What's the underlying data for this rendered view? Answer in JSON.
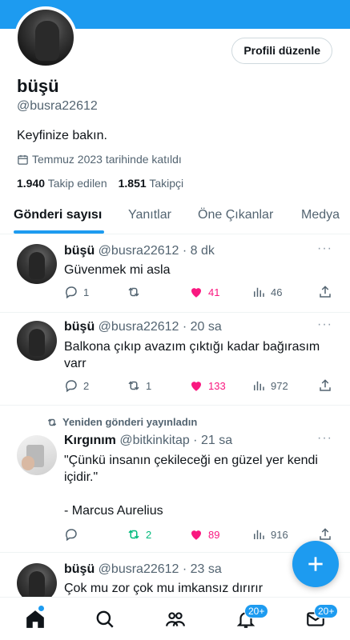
{
  "profile": {
    "name": "büşü",
    "handle": "@busra22612",
    "bio": "Keyfinize bakın.",
    "joined": "Temmuz 2023 tarihinde katıldı",
    "following_count": "1.940",
    "following_label": "Takip edilen",
    "followers_count": "1.851",
    "followers_label": "Takipçi",
    "edit_button": "Profili düzenle"
  },
  "tabs": [
    {
      "label": "Gönderi sayısı",
      "active": true
    },
    {
      "label": "Yanıtlar",
      "active": false
    },
    {
      "label": "Öne Çıkanlar",
      "active": false
    },
    {
      "label": "Medya",
      "active": false
    }
  ],
  "tweets": [
    {
      "name": "büşü",
      "meta": "@busra22612 · 8 dk",
      "text": "Güvenmek mi asla",
      "replies": "1",
      "retweets": "",
      "likes": "41",
      "views": "46"
    },
    {
      "name": "büşü",
      "meta": "@busra22612 · 20 sa",
      "text": "Balkona çıkıp avazım çıktığı kadar bağırasım varr",
      "replies": "2",
      "retweets": "1",
      "likes": "133",
      "views": "972"
    },
    {
      "retweeted_label": "Yeniden gönderi yayınladın",
      "name": "Kırgınım",
      "meta": "@bitkinkitap · 21 sa",
      "text": "\"Çünkü insanın çekileceği en güzel yer kendi içidir.\"\n\n- Marcus Aurelius",
      "replies": "",
      "retweets": "2",
      "likes": "89",
      "views": "916"
    },
    {
      "name": "büşü",
      "meta": "@busra22612 · 23 sa",
      "text": "Çok mu zor çok mu imkansız dırırır"
    }
  ],
  "more_glyph": "···",
  "nav": {
    "notifications_badge": "20+",
    "messages_badge": "20+"
  },
  "colors": {
    "accent": "#1d9bf0",
    "like": "#f91880",
    "retweet": "#00ba7c",
    "secondary_text": "#536471"
  },
  "icons": [
    "calendar-icon",
    "reply-icon",
    "retweet-icon",
    "heart-icon",
    "views-icon",
    "share-icon",
    "more-icon",
    "plus-icon",
    "home-icon",
    "search-icon",
    "communities-icon",
    "bell-icon",
    "mail-icon"
  ]
}
